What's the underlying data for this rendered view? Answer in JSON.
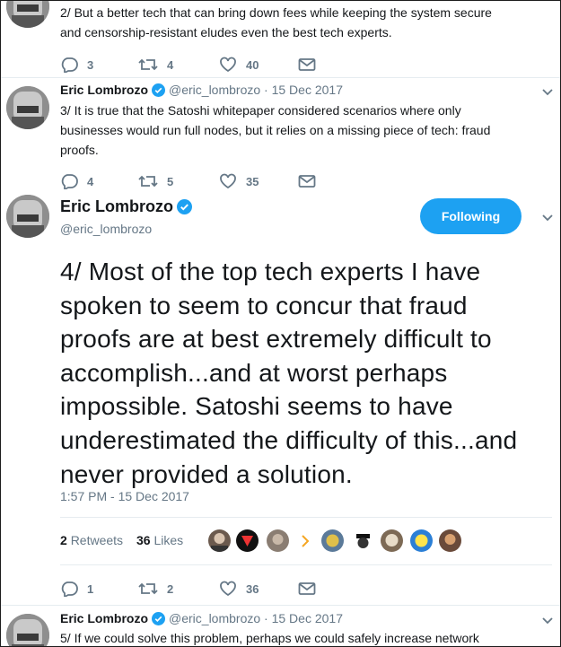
{
  "tweet2": {
    "line1": "2/ But a better tech that can bring down fees while keeping the system secure",
    "line2": "and censorship-resistant eludes even the best tech experts.",
    "replies": "3",
    "retweets": "4",
    "likes": "40"
  },
  "tweet3": {
    "name": "Eric Lombrozo",
    "handle": "@eric_lombrozo",
    "date": "· 15 Dec 2017",
    "line1": "3/ It is true that the Satoshi whitepaper considered scenarios where only",
    "line2": "businesses would run full nodes, but it relies on a missing piece of tech: fraud",
    "line3": "proofs.",
    "replies": "4",
    "retweets": "5",
    "likes": "35"
  },
  "main_tweet": {
    "name": "Eric Lombrozo",
    "handle": "@eric_lombrozo",
    "follow_label": "Following",
    "text_lines": [
      "4/ Most of the top tech experts I have",
      "spoken to seem to concur that fraud",
      "proofs are at best extremely difficult to",
      "accomplish...and at worst perhaps",
      "impossible. Satoshi seems to have",
      "underestimated the difficulty of this...and",
      "never provided a solution."
    ],
    "timestamp": "1:57 PM - 15 Dec 2017",
    "retweet_count": "2",
    "retweet_label": "Retweets",
    "like_count": "36",
    "like_label": "Likes",
    "replies": "1",
    "retweets": "2",
    "likes": "36"
  },
  "tweet5": {
    "name": "Eric Lombrozo",
    "handle": "@eric_lombrozo",
    "date": "· 15 Dec 2017",
    "line1": "5/ If we could solve this problem, perhaps we could safely increase network"
  },
  "colors": {
    "accent": "#1da1f2",
    "muted": "#657786",
    "text": "#14171a",
    "border": "#e6ecf0"
  }
}
